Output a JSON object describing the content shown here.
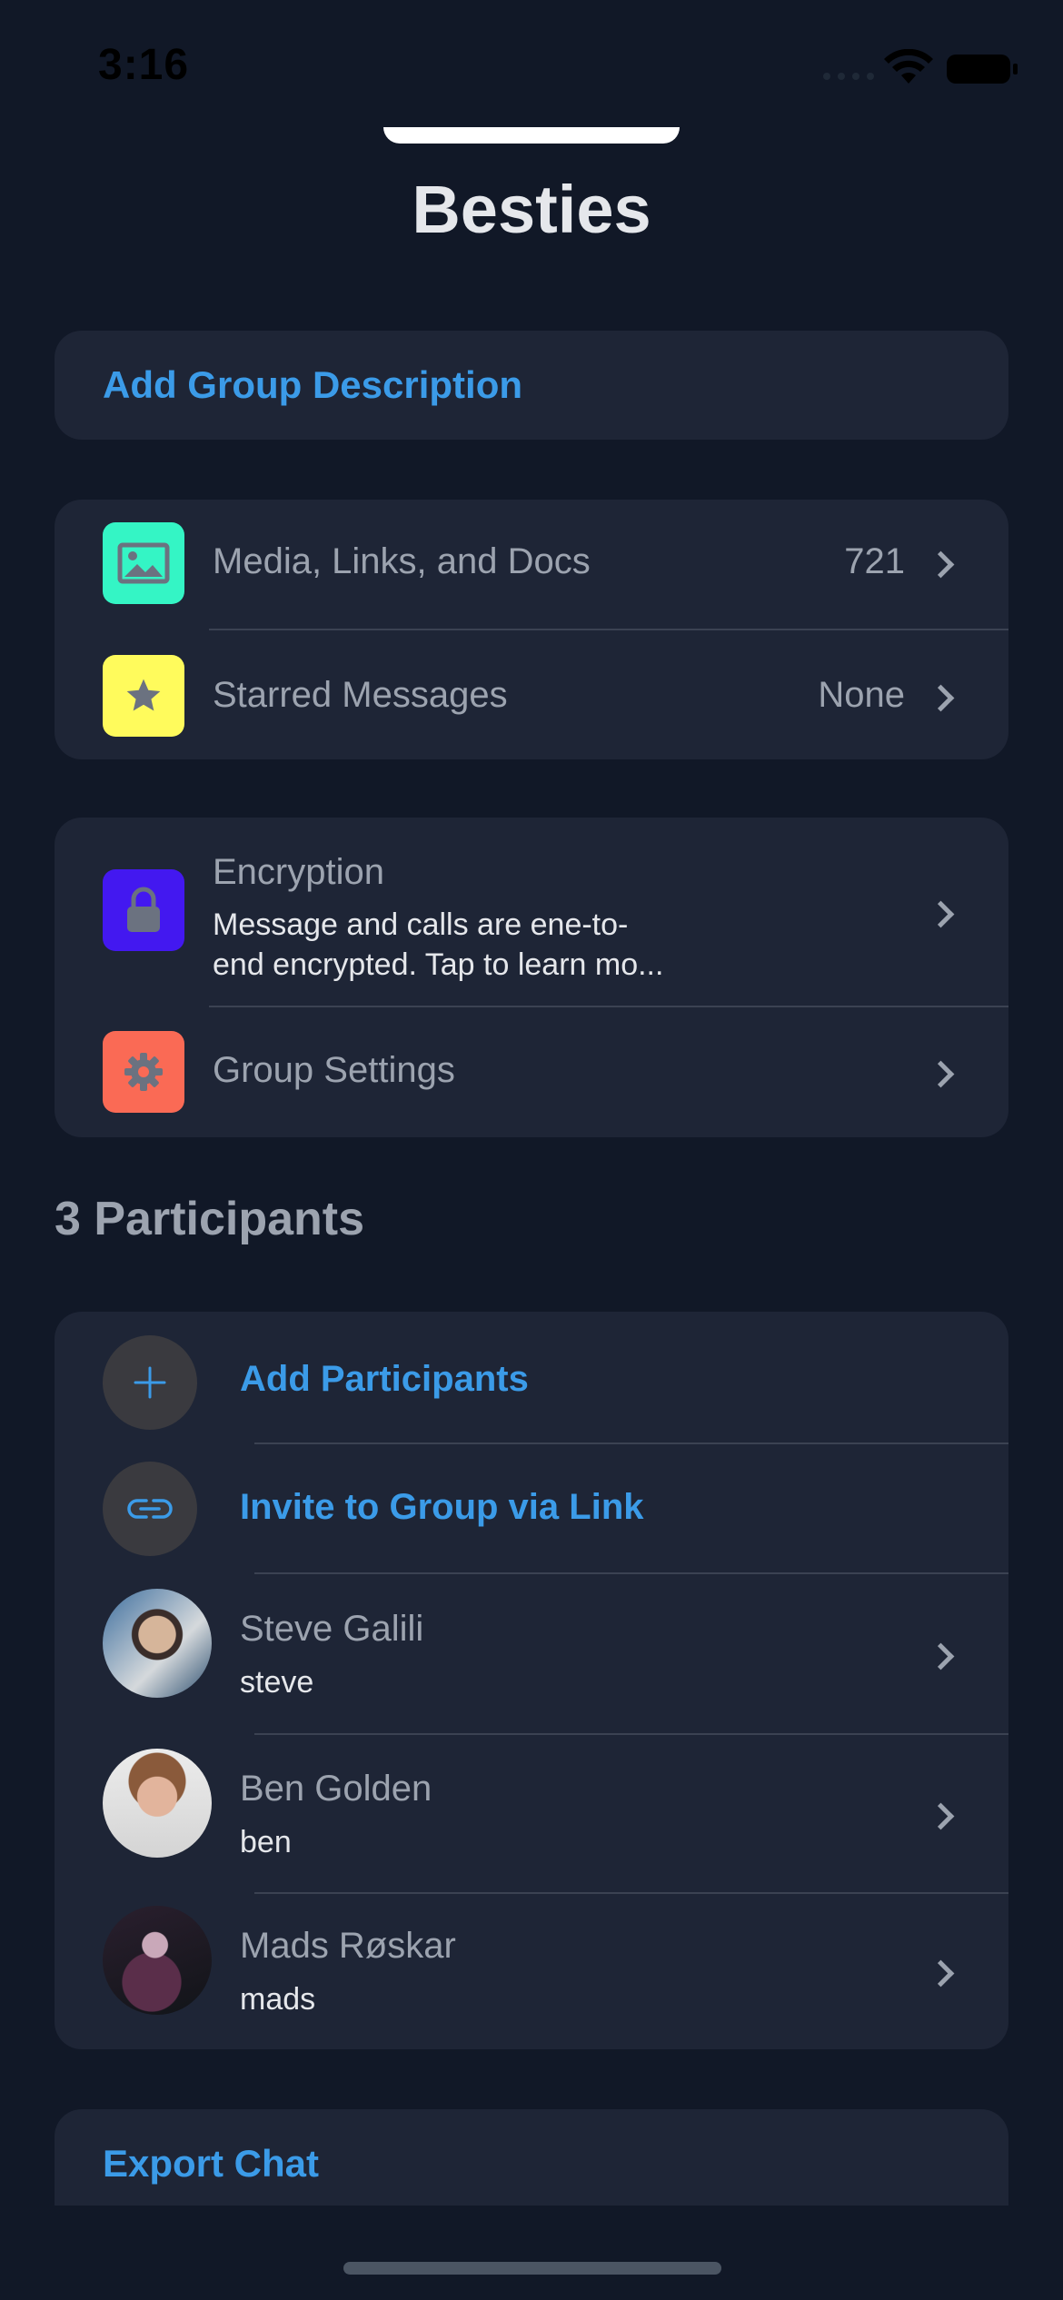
{
  "status_bar": {
    "time": "3:16"
  },
  "header": {
    "title": "Besties"
  },
  "description": {
    "label": "Add Group Description"
  },
  "media_card": {
    "items": [
      {
        "label": "Media, Links, and Docs",
        "value": "721",
        "icon": "image-icon",
        "icon_color": "#34f5c5"
      },
      {
        "label": "Starred Messages",
        "value": "None",
        "icon": "star-icon",
        "icon_color": "#fffb5c"
      }
    ]
  },
  "settings_card": {
    "encryption": {
      "label": "Encryption",
      "line1": "Message and calls are ene-to-",
      "line2": "end encrypted. Tap to learn mo...",
      "icon": "lock-icon",
      "icon_color": "#4318f0"
    },
    "group_settings": {
      "label": "Group Settings",
      "icon": "gear-icon",
      "icon_color": "#fa6a55"
    }
  },
  "participants": {
    "heading": "3 Participants",
    "add_label": "Add Participants",
    "invite_label": "Invite to Group via Link",
    "people": [
      {
        "name": "Steve Galili",
        "username": "steve"
      },
      {
        "name": "Ben Golden",
        "username": "ben"
      },
      {
        "name": "Mads Røskar",
        "username": "mads"
      }
    ]
  },
  "export": {
    "label": "Export Chat"
  },
  "colors": {
    "accent": "#3b9be8",
    "background": "#111827",
    "card": "#1e2536"
  }
}
